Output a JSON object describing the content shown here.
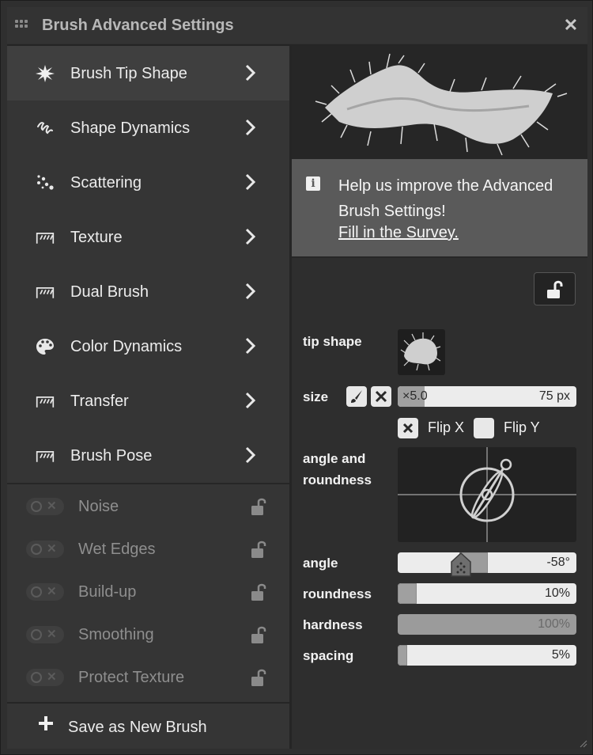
{
  "window": {
    "title": "Brush Advanced Settings"
  },
  "menu": [
    {
      "label": "Brush Tip Shape",
      "icon": "brush-tip-icon",
      "active": true
    },
    {
      "label": "Shape Dynamics",
      "icon": "shape-dynamics-icon"
    },
    {
      "label": "Scattering",
      "icon": "scattering-icon"
    },
    {
      "label": "Texture",
      "icon": "texture-icon"
    },
    {
      "label": "Dual Brush",
      "icon": "dual-brush-icon"
    },
    {
      "label": "Color Dynamics",
      "icon": "palette-icon"
    },
    {
      "label": "Transfer",
      "icon": "transfer-icon"
    },
    {
      "label": "Brush Pose",
      "icon": "brush-pose-icon"
    }
  ],
  "toggles": [
    {
      "label": "Noise",
      "on": false
    },
    {
      "label": "Wet Edges",
      "on": false
    },
    {
      "label": "Build-up",
      "on": false
    },
    {
      "label": "Smoothing",
      "on": false
    },
    {
      "label": "Protect Texture",
      "on": false
    }
  ],
  "save": {
    "label": "Save as New Brush"
  },
  "banner": {
    "text": "Help us improve the Advanced Brush Settings!",
    "link": "Fill in the Survey."
  },
  "params": {
    "tip_shape_label": "tip shape",
    "size_label": "size",
    "size_multiplier": "×5.0",
    "size_value": "75 px",
    "flip_x_label": "Flip X",
    "flip_x_checked": true,
    "flip_y_label": "Flip Y",
    "flip_y_checked": false,
    "angle_roundness_label": "angle and roundness",
    "angle_label": "angle",
    "angle_value": "-58°",
    "roundness_label": "roundness",
    "roundness_value": "10%",
    "hardness_label": "hardness",
    "hardness_value": "100%",
    "spacing_label": "spacing",
    "spacing_value": "5%"
  },
  "colors": {
    "panel_bg": "#2f2f2f",
    "active_item": "#3f3f3f",
    "banner_bg": "#5a5a5a",
    "slider_track": "#ececec",
    "slider_fill": "#a0a0a0"
  }
}
